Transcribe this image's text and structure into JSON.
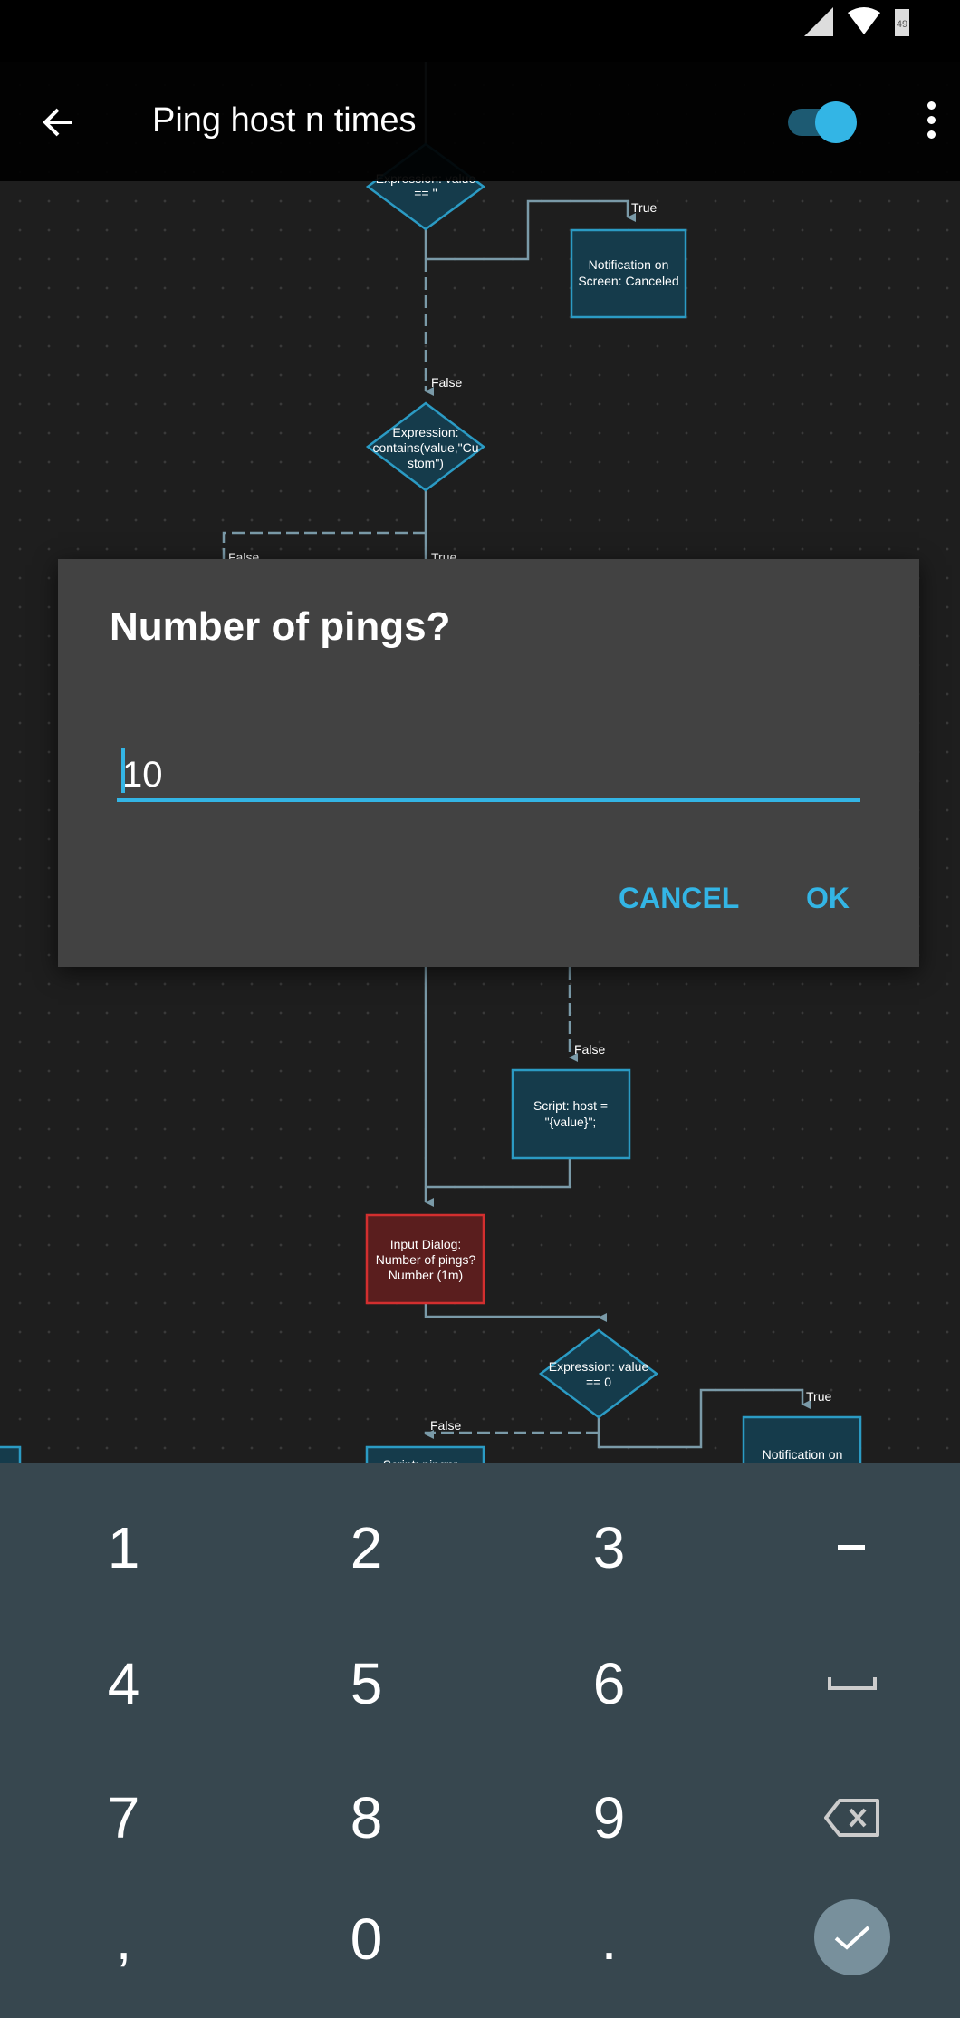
{
  "status_bar": {
    "battery_level": "49",
    "icons": [
      "signal-icon",
      "wifi-icon",
      "battery-icon"
    ]
  },
  "toolbar": {
    "title": "Ping host n times",
    "back_icon": "arrow-left-icon",
    "enabled": true,
    "menu_icon": "more-vert-icon"
  },
  "diagram": {
    "node1": [
      "Expression: value",
      "== ''"
    ],
    "node2": [
      "Notification on",
      "Screen: Canceled"
    ],
    "node3": [
      "Expression:",
      "contains(value,\"Cu",
      "stom\")"
    ],
    "node4": [
      "Script: host =",
      "\"{value}\";"
    ],
    "node5": [
      "Input Dialog:",
      "Number of pings?",
      "Number (1m)"
    ],
    "node6": [
      "Expression: value",
      "== 0"
    ],
    "node7": [
      "Notification on"
    ],
    "node8": [
      "Script: pingnr ="
    ],
    "labels": {
      "true": "True",
      "false": "False"
    }
  },
  "dialog": {
    "title": "Number of pings?",
    "input_value": "10",
    "cancel_label": "CANCEL",
    "ok_label": "OK"
  },
  "keyboard": {
    "keys": [
      "1",
      "2",
      "3",
      "–",
      "4",
      "5",
      "6",
      "space",
      "7",
      "8",
      "9",
      "backspace",
      ",",
      "0",
      ".",
      "done"
    ]
  },
  "colors": {
    "accent": "#33b5e5",
    "node_fill": "#153b4b",
    "node_border": "#2b9bc4",
    "active_node_fill": "#5a1e1e",
    "active_node_border": "#d32f2f",
    "keyboard_bg": "#37474f",
    "dialog_bg": "#424242"
  }
}
